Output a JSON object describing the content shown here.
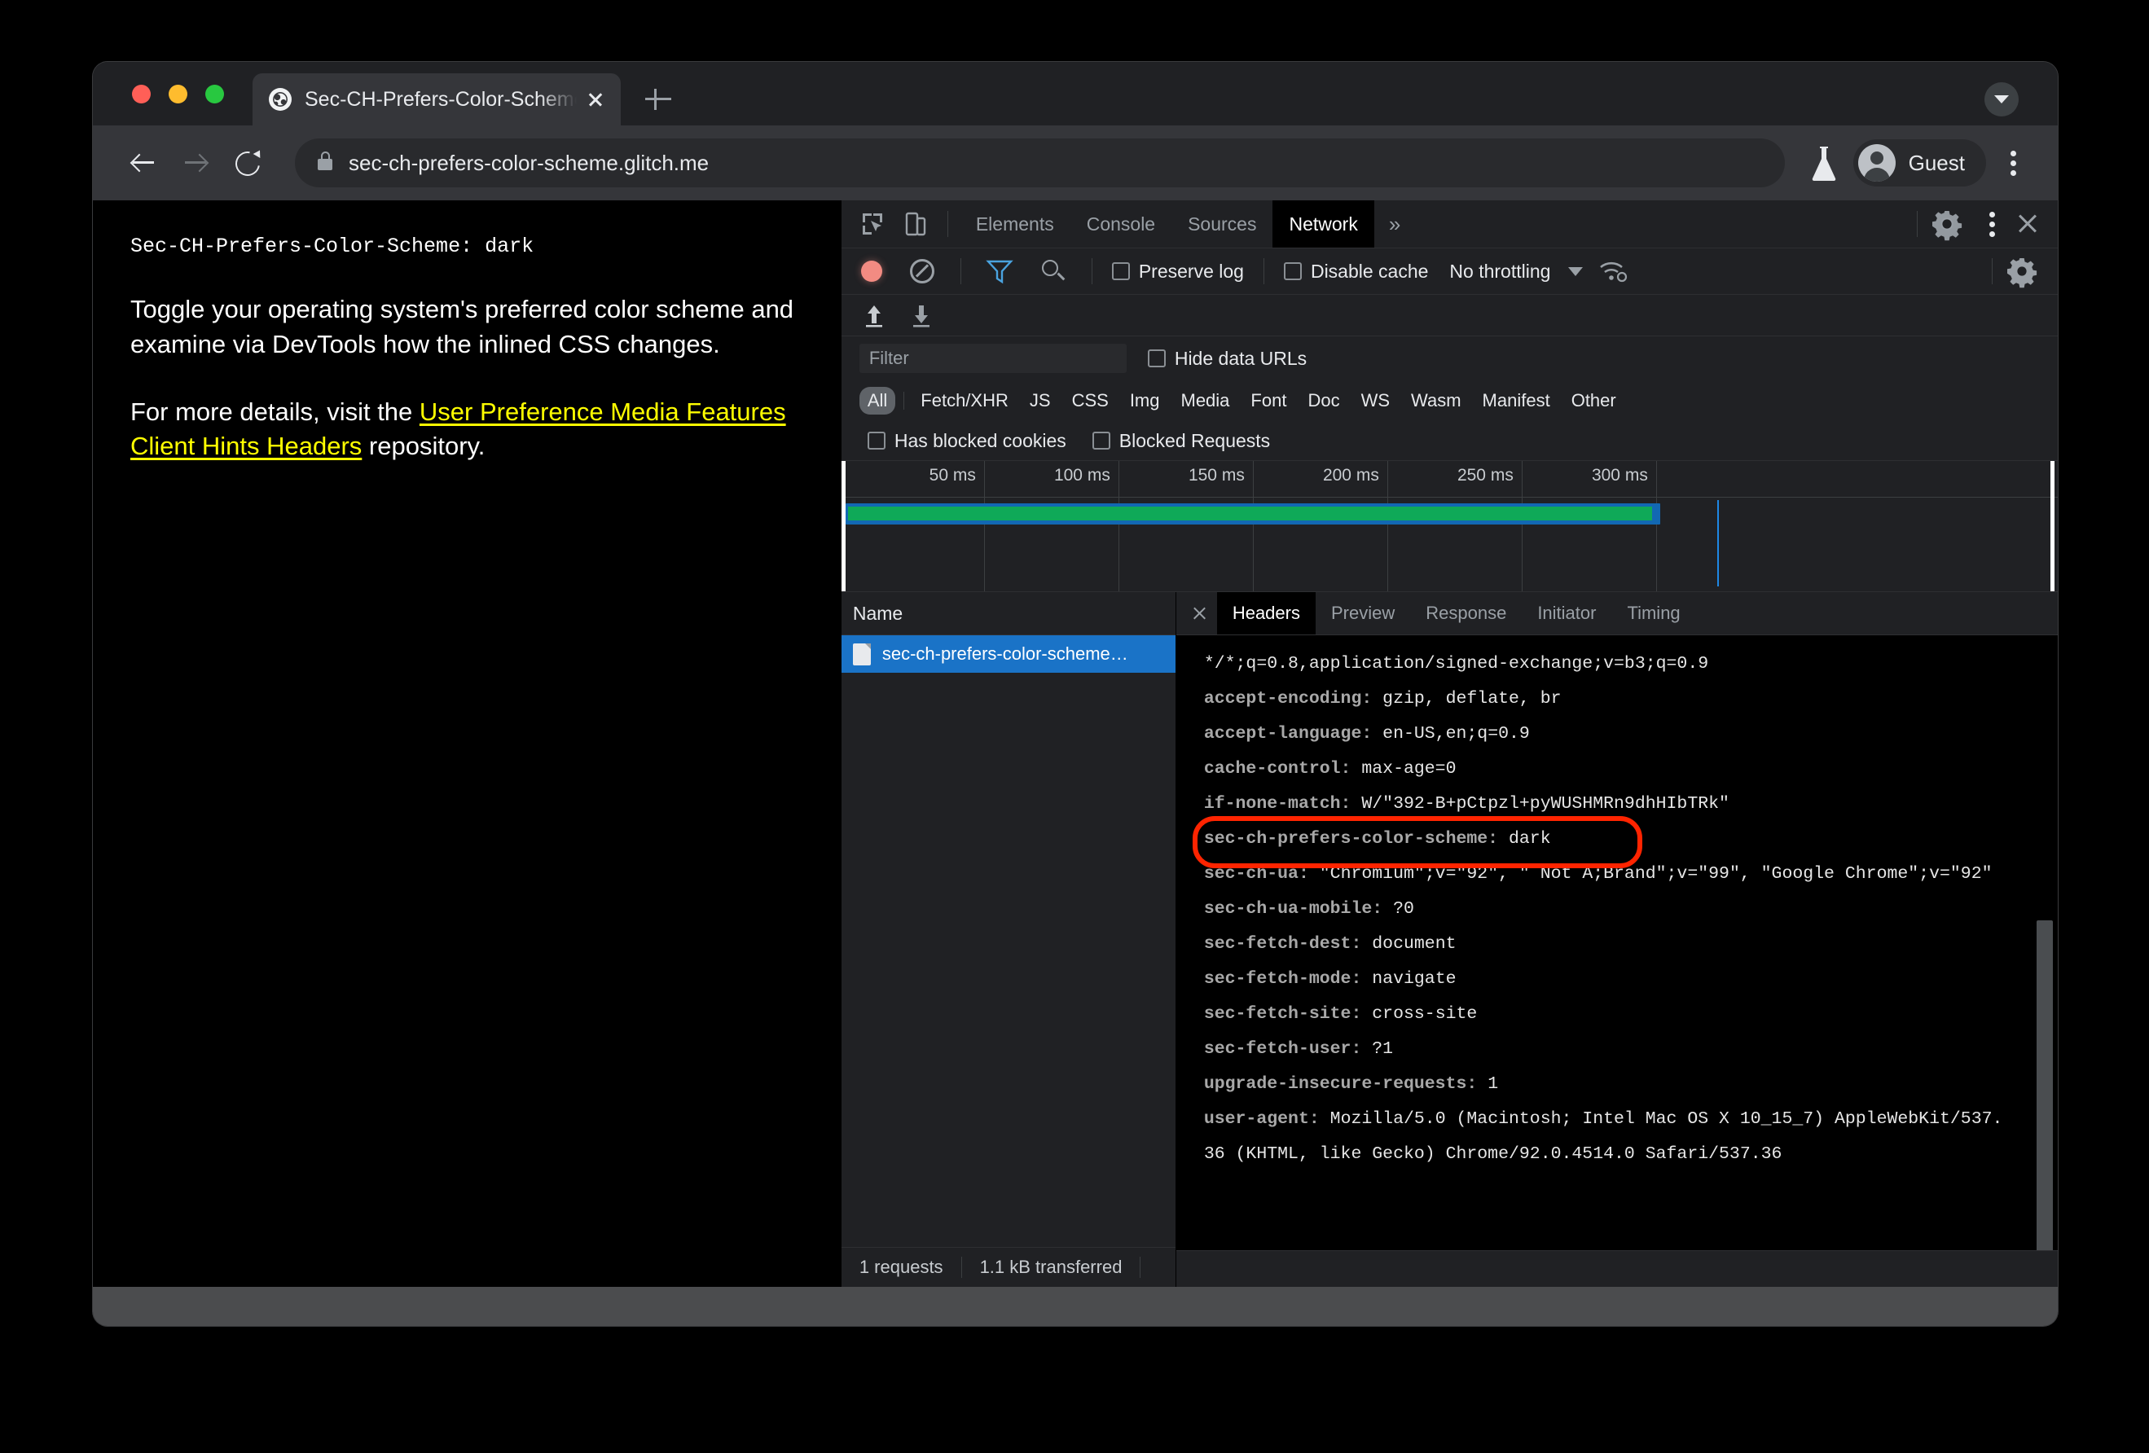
{
  "browser": {
    "tab": {
      "title": "Sec-CH-Prefers-Color-Scheme",
      "close_label": "×"
    },
    "new_tab_label": "+",
    "omnibox": {
      "url": "sec-ch-prefers-color-scheme.glitch.me"
    },
    "profile": {
      "label": "Guest"
    }
  },
  "page": {
    "header_line": "Sec-CH-Prefers-Color-Scheme: dark",
    "paragraph1": "Toggle your operating system's preferred color scheme and examine via DevTools how the inlined CSS changes.",
    "paragraph2_prefix": "For more details, visit the ",
    "paragraph2_link": "User Preference Media Features Client Hints Headers",
    "paragraph2_suffix": " repository."
  },
  "devtools": {
    "panels": [
      {
        "label": "Elements",
        "active": false
      },
      {
        "label": "Console",
        "active": false
      },
      {
        "label": "Sources",
        "active": false
      },
      {
        "label": "Network",
        "active": true
      }
    ],
    "more_panels_label": "»",
    "controls": {
      "preserve_log_label": "Preserve log",
      "disable_cache_label": "Disable cache",
      "throttling_value": "No throttling"
    },
    "filter": {
      "placeholder": "Filter",
      "value": "",
      "hide_data_urls_label": "Hide data URLs"
    },
    "resource_types": [
      {
        "label": "All",
        "active": true
      },
      {
        "label": "Fetch/XHR",
        "active": false
      },
      {
        "label": "JS",
        "active": false
      },
      {
        "label": "CSS",
        "active": false
      },
      {
        "label": "Img",
        "active": false
      },
      {
        "label": "Media",
        "active": false
      },
      {
        "label": "Font",
        "active": false
      },
      {
        "label": "Doc",
        "active": false
      },
      {
        "label": "WS",
        "active": false
      },
      {
        "label": "Wasm",
        "active": false
      },
      {
        "label": "Manifest",
        "active": false
      },
      {
        "label": "Other",
        "active": false
      }
    ],
    "blocked": {
      "has_blocked_cookies_label": "Has blocked cookies",
      "blocked_requests_label": "Blocked Requests"
    },
    "overview": {
      "ticks": [
        "50 ms",
        "100 ms",
        "150 ms",
        "200 ms",
        "250 ms",
        "300 ms"
      ],
      "band_color": "#1268b3",
      "band_inner_color": "#0fa958"
    },
    "requests_table": {
      "column_name": "Name",
      "rows": [
        {
          "name": "sec-ch-prefers-color-scheme…",
          "selected": true
        }
      ]
    },
    "status_bar": {
      "requests": "1 requests",
      "transferred": "1.1 kB transferred"
    },
    "detail_tabs": [
      {
        "label": "Headers",
        "active": true
      },
      {
        "label": "Preview",
        "active": false
      },
      {
        "label": "Response",
        "active": false
      },
      {
        "label": "Initiator",
        "active": false
      },
      {
        "label": "Timing",
        "active": false
      }
    ],
    "headers": [
      {
        "name": "",
        "value": "*/*;q=0.8,application/signed-exchange;v=b3;q=0.9",
        "highlighted": false
      },
      {
        "name": "accept-encoding:",
        "value": " gzip, deflate, br",
        "highlighted": false
      },
      {
        "name": "accept-language:",
        "value": " en-US,en;q=0.9",
        "highlighted": false
      },
      {
        "name": "cache-control:",
        "value": " max-age=0",
        "highlighted": false
      },
      {
        "name": "if-none-match:",
        "value": " W/\"392-B+pCtpzl+pyWUSHMRn9dhHIbTRk\"",
        "highlighted": false
      },
      {
        "name": "sec-ch-prefers-color-scheme:",
        "value": " dark",
        "highlighted": true
      },
      {
        "name": "sec-ch-ua:",
        "value": " \"Chromium\";v=\"92\", \" Not A;Brand\";v=\"99\", \"Google Chrome\";v=\"92\"",
        "highlighted": false
      },
      {
        "name": "sec-ch-ua-mobile:",
        "value": " ?0",
        "highlighted": false
      },
      {
        "name": "sec-fetch-dest:",
        "value": " document",
        "highlighted": false
      },
      {
        "name": "sec-fetch-mode:",
        "value": " navigate",
        "highlighted": false
      },
      {
        "name": "sec-fetch-site:",
        "value": " cross-site",
        "highlighted": false
      },
      {
        "name": "sec-fetch-user:",
        "value": " ?1",
        "highlighted": false
      },
      {
        "name": "upgrade-insecure-requests:",
        "value": " 1",
        "highlighted": false
      },
      {
        "name": "user-agent:",
        "value": " Mozilla/5.0 (Macintosh; Intel Mac OS X 10_15_7) AppleWebKit/537.36 (KHTML, like Gecko) Chrome/92.0.4514.0 Safari/537.36",
        "highlighted": false
      }
    ]
  },
  "colors": {
    "annotation": "#ff2400",
    "selection": "#1a73c7",
    "link": "#ffff00"
  }
}
